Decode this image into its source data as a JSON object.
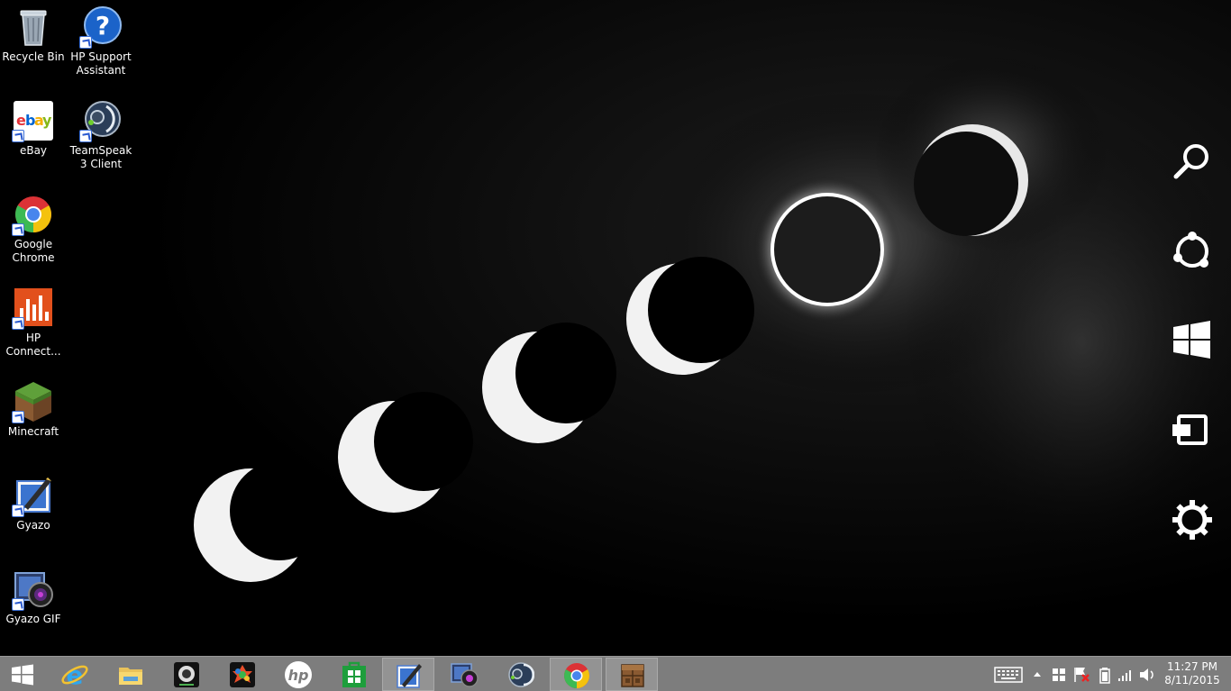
{
  "desktop": {
    "icons": [
      {
        "label": "Recycle Bin",
        "icon": "recycle-bin-icon"
      },
      {
        "label": "HP Support Assistant",
        "icon": "hp-support-icon"
      },
      {
        "label": "eBay",
        "icon": "ebay-icon"
      },
      {
        "label": "TeamSpeak 3 Client",
        "icon": "teamspeak-icon"
      },
      {
        "label": "Google Chrome",
        "icon": "chrome-icon"
      },
      {
        "label": "HP Connect...",
        "icon": "hp-connect-icon"
      },
      {
        "label": "Minecraft",
        "icon": "minecraft-icon"
      },
      {
        "label": "Gyazo",
        "icon": "gyazo-icon"
      },
      {
        "label": "Gyazo GIF",
        "icon": "gyazo-gif-icon"
      }
    ]
  },
  "charms": [
    "search-icon",
    "share-icon",
    "start-icon",
    "devices-icon",
    "settings-icon"
  ],
  "taskbar": {
    "items": [
      {
        "icon": "start-button-icon",
        "open": false
      },
      {
        "icon": "internet-explorer-icon",
        "open": false
      },
      {
        "icon": "file-explorer-icon",
        "open": false
      },
      {
        "icon": "webcam-icon",
        "open": false
      },
      {
        "icon": "photo-gallery-icon",
        "open": false
      },
      {
        "icon": "hp-icon",
        "open": false
      },
      {
        "icon": "store-icon",
        "open": false
      },
      {
        "icon": "gyazo-icon",
        "open": true
      },
      {
        "icon": "gyazo-gif-icon",
        "open": false
      },
      {
        "icon": "teamspeak-icon",
        "open": false
      },
      {
        "icon": "chrome-icon",
        "open": true
      },
      {
        "icon": "minecraft-icon",
        "open": true
      }
    ],
    "tray": {
      "icons": [
        "touch-keyboard-icon",
        "show-hidden-icons-icon",
        "action-center-icon",
        "battery-icon",
        "network-icon",
        "volume-icon"
      ],
      "time": "11:27 PM",
      "date": "8/11/2015"
    }
  },
  "colors": {
    "taskbar": "#7d7d7d",
    "taskbar_active": "#939393",
    "store_green": "#1e9e3c",
    "hp_orange": "#e2501c"
  }
}
